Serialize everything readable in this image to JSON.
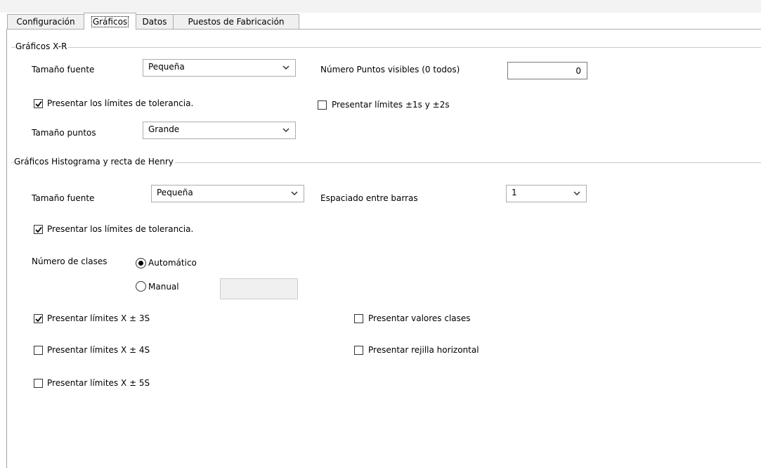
{
  "tabs": [
    {
      "label": "Configuración"
    },
    {
      "label": "Gráficos"
    },
    {
      "label": "Datos"
    },
    {
      "label": "Puestos de Fabricación"
    }
  ],
  "xr": {
    "title": "Gráficos X-R",
    "font_size_label": "Tamaño fuente",
    "font_size_value": "Pequeña",
    "visible_points_label": "Número Puntos visibles (0 todos)",
    "visible_points_value": "0",
    "show_tolerance_label": "Presentar los límites de tolerancia.",
    "show_tolerance_checked": true,
    "show_1s2s_label": "Presentar límites ±1s y ±2s",
    "show_1s2s_checked": false,
    "point_size_label": "Tamaño puntos",
    "point_size_value": "Grande"
  },
  "hist": {
    "title": "Gráficos Histograma y recta de Henry",
    "font_size_label": "Tamaño fuente",
    "font_size_value": "Pequeña",
    "bar_spacing_label": "Espaciado entre barras",
    "bar_spacing_value": "1",
    "show_tolerance_label": "Presentar los límites de tolerancia.",
    "show_tolerance_checked": true,
    "classes_label": "Número de clases",
    "auto_label": "Automático",
    "auto_selected": true,
    "manual_label": "Manual",
    "manual_value": "",
    "limits_3s_label": "Presentar límites X ± 3S",
    "limits_3s_checked": true,
    "limits_4s_label": "Presentar límites X ± 4S",
    "limits_4s_checked": false,
    "limits_5s_label": "Presentar límites X ± 5S",
    "limits_5s_checked": false,
    "class_values_label": "Presentar valores clases",
    "class_values_checked": false,
    "grid_label": "Presentar rejilla horizontal",
    "grid_checked": false
  }
}
